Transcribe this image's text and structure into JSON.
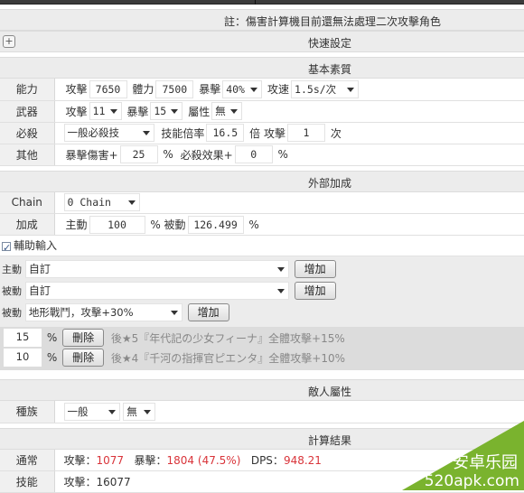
{
  "note": "註：傷害計算機目前還無法處理二次攻擊角色",
  "quick_settings": {
    "title": "快速設定",
    "expand_icon": "plus-icon"
  },
  "basic": {
    "title": "基本素質",
    "rows": {
      "ability": {
        "label": "能力",
        "atk_label": "攻擊",
        "atk": "7650",
        "hp_label": "體力",
        "hp": "7500",
        "crit_label": "暴擊",
        "crit": "40%",
        "speed_label": "攻速",
        "speed": "1.5s/次"
      },
      "weapon": {
        "label": "武器",
        "atk_label": "攻擊",
        "atk": "11",
        "crit_label": "暴擊",
        "crit": "15",
        "attr_label": "屬性",
        "attr": "無"
      },
      "skill": {
        "label": "必殺",
        "type": "一般必殺技",
        "rate_label": "技能倍率",
        "rate": "16.5",
        "times_label": "倍 攻擊",
        "times": "1",
        "times_unit": "次"
      },
      "other": {
        "label": "其他",
        "critdmg_label": "暴擊傷害+",
        "critdmg": "25",
        "pct1": "%",
        "skilleff_label": "必殺效果+",
        "skilleff": "0",
        "pct2": "%"
      }
    }
  },
  "external": {
    "title": "外部加成",
    "chain": {
      "label": "Chain",
      "value": "0 Chain"
    },
    "bonus": {
      "label": "加成",
      "active_label": "主動",
      "active": "100",
      "pct1": "% 被動",
      "passive": "126.499",
      "pct2": "%"
    }
  },
  "aux": {
    "label": "輔助輸入",
    "checked": true,
    "active": {
      "label": "主動",
      "value": "自訂",
      "button": "增加"
    },
    "passive": {
      "label": "被動",
      "value": "自訂",
      "button": "增加"
    },
    "passive2": {
      "label": "被動",
      "value": "地形戰鬥，攻擊+30%",
      "button": "增加"
    },
    "entries": [
      {
        "value": "15",
        "unit": "%",
        "button": "刪除",
        "desc": "後★5『年代記の少女フィーナ』全體攻擊+15%"
      },
      {
        "value": "10",
        "unit": "%",
        "button": "刪除",
        "desc": "後★4『千河の指揮官ピエンタ』全體攻擊+10%"
      }
    ]
  },
  "enemy": {
    "title": "敵人屬性",
    "race": {
      "label": "種族",
      "value": "一般",
      "attr": "無"
    }
  },
  "results": {
    "title": "計算結果",
    "normal": {
      "label": "通常",
      "atk_label": "攻擊：",
      "atk": "1077",
      "crit_label": "暴擊：",
      "crit": "1804 (47.5%)",
      "dps_label": "DPS：",
      "dps": "948.21"
    },
    "skill": {
      "label": "技能",
      "atk_label": "攻擊：",
      "atk": "16077"
    }
  },
  "watermark": {
    "line1": "安卓乐园",
    "line2": "520apk.com",
    "color": "#7ab32e"
  }
}
